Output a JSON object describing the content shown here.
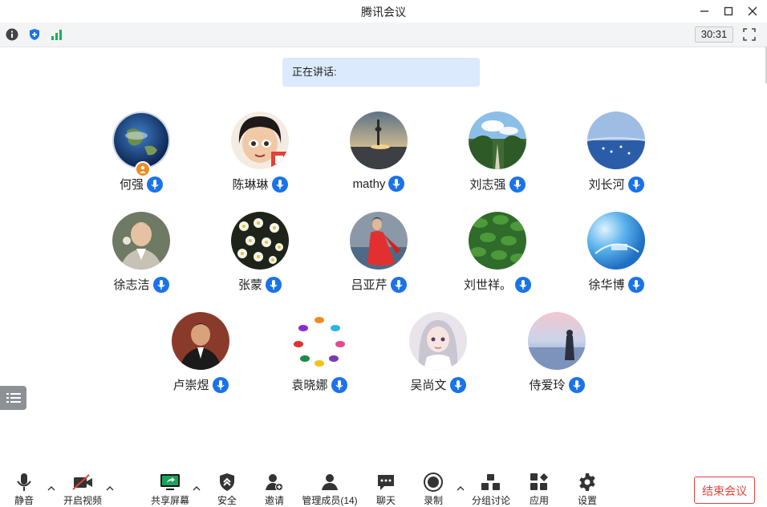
{
  "window": {
    "title": "腾讯会议"
  },
  "infobar": {
    "timer": "30:31"
  },
  "speaking": {
    "label": "正在讲话:"
  },
  "participants": [
    {
      "name": "何强",
      "host": true
    },
    {
      "name": "陈琳琳"
    },
    {
      "name": "mathy"
    },
    {
      "name": "刘志强"
    },
    {
      "name": "刘长河"
    },
    {
      "name": "徐志洁"
    },
    {
      "name": "张蒙"
    },
    {
      "name": "吕亚芹"
    },
    {
      "name": "刘世祥。"
    },
    {
      "name": "徐华博"
    },
    {
      "name": "卢崇煜"
    },
    {
      "name": "袁晓娜"
    },
    {
      "name": "吴尚文"
    },
    {
      "name": "侍爱玲"
    }
  ],
  "toolbar": {
    "mute": "静音",
    "video": "开启视频",
    "share": "共享屏幕",
    "security": "安全",
    "invite": "邀请",
    "members": "管理成员(14)",
    "chat": "聊天",
    "record": "录制",
    "breakout": "分组讨论",
    "apps": "应用",
    "settings": "设置",
    "end": "结束会议"
  },
  "colors": {
    "accent": "#1a73e8",
    "danger": "#e0433a",
    "speaking_bg": "#dbeafc"
  }
}
